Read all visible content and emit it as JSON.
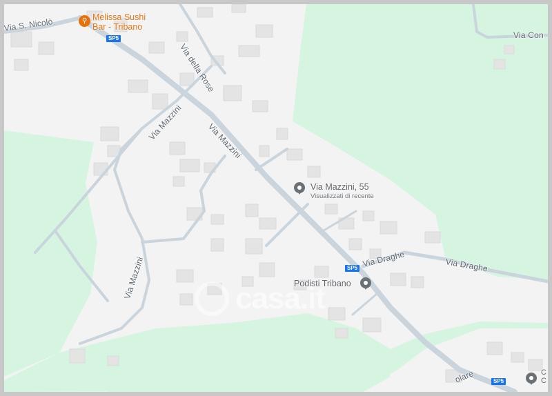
{
  "map": {
    "colors": {
      "green": "#d6f5e1",
      "land": "#f3f3f3",
      "road": "#c9d4dc",
      "building": "#e4e4e4",
      "shield": "#1a73e8",
      "poi_food": "#e8710a",
      "poi_pin": "#6b7075"
    },
    "roads": {
      "via_s_nicolo": "Via S. Nicolò",
      "via_della_rose": "Via della Rose",
      "via_mazzini_diag": "Via Mazzini",
      "via_mazzini_upper": "Via Mazzini",
      "via_mazzini_lower": "Via Mazzini",
      "via_draghe_1": "Via Draghe",
      "via_draghe_2": "Via Draghe",
      "via_con": "Via Con",
      "via_olare": "olare"
    },
    "shields": {
      "sp5_top": "SP5",
      "sp5_mid": "SP5",
      "sp5_bottom": "SP5"
    },
    "pois": {
      "sushi": {
        "icon": "restaurant-icon",
        "name_line1": "Melissa Sushi",
        "name_line2": "Bar - Tribano"
      },
      "via_mazzini_55": {
        "icon": "location-pin-icon",
        "name": "Via Mazzini, 55",
        "sub": "Visualizzati di recente"
      },
      "podisti": {
        "icon": "location-pin-icon",
        "name": "Podisti Tribano"
      },
      "edge_pin": {
        "icon": "location-pin-icon",
        "name_line1": "C",
        "name_line2": "C"
      }
    },
    "watermark": {
      "text": "casa.it",
      "icon": "casa-logo-icon"
    }
  }
}
